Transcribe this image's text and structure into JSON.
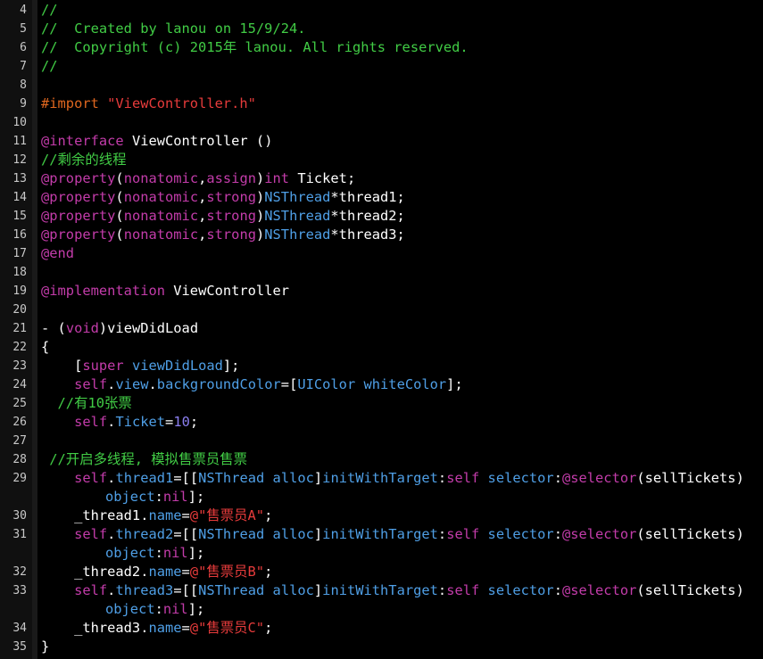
{
  "editor": {
    "lines": [
      {
        "n": "4",
        "tokens": [
          {
            "t": "//",
            "c": "comment"
          }
        ]
      },
      {
        "n": "5",
        "tokens": [
          {
            "t": "//  Created by lanou on 15/9/24.",
            "c": "comment"
          }
        ]
      },
      {
        "n": "6",
        "tokens": [
          {
            "t": "//  Copyright (c) 2015年 lanou. All rights reserved.",
            "c": "comment"
          }
        ]
      },
      {
        "n": "7",
        "tokens": [
          {
            "t": "//",
            "c": "comment"
          }
        ]
      },
      {
        "n": "8",
        "tokens": []
      },
      {
        "n": "9",
        "tokens": [
          {
            "t": "#import ",
            "c": "directive"
          },
          {
            "t": "\"ViewController.h\"",
            "c": "string"
          }
        ]
      },
      {
        "n": "10",
        "tokens": []
      },
      {
        "n": "11",
        "tokens": [
          {
            "t": "@interface",
            "c": "keyword"
          },
          {
            "t": " ViewController ()",
            "c": "plain"
          }
        ]
      },
      {
        "n": "12",
        "tokens": [
          {
            "t": "//剩余的线程",
            "c": "comment"
          }
        ]
      },
      {
        "n": "13",
        "tokens": [
          {
            "t": "@property",
            "c": "keyword"
          },
          {
            "t": "(",
            "c": "plain"
          },
          {
            "t": "nonatomic",
            "c": "keyword"
          },
          {
            "t": ",",
            "c": "plain"
          },
          {
            "t": "assign",
            "c": "keyword"
          },
          {
            "t": ")",
            "c": "plain"
          },
          {
            "t": "int",
            "c": "keyword"
          },
          {
            "t": " Ticket;",
            "c": "plain"
          }
        ]
      },
      {
        "n": "14",
        "tokens": [
          {
            "t": "@property",
            "c": "keyword"
          },
          {
            "t": "(",
            "c": "plain"
          },
          {
            "t": "nonatomic",
            "c": "keyword"
          },
          {
            "t": ",",
            "c": "plain"
          },
          {
            "t": "strong",
            "c": "keyword"
          },
          {
            "t": ")",
            "c": "plain"
          },
          {
            "t": "NSThread",
            "c": "type"
          },
          {
            "t": "*thread1;",
            "c": "plain"
          }
        ]
      },
      {
        "n": "15",
        "tokens": [
          {
            "t": "@property",
            "c": "keyword"
          },
          {
            "t": "(",
            "c": "plain"
          },
          {
            "t": "nonatomic",
            "c": "keyword"
          },
          {
            "t": ",",
            "c": "plain"
          },
          {
            "t": "strong",
            "c": "keyword"
          },
          {
            "t": ")",
            "c": "plain"
          },
          {
            "t": "NSThread",
            "c": "type"
          },
          {
            "t": "*thread2;",
            "c": "plain"
          }
        ]
      },
      {
        "n": "16",
        "tokens": [
          {
            "t": "@property",
            "c": "keyword"
          },
          {
            "t": "(",
            "c": "plain"
          },
          {
            "t": "nonatomic",
            "c": "keyword"
          },
          {
            "t": ",",
            "c": "plain"
          },
          {
            "t": "strong",
            "c": "keyword"
          },
          {
            "t": ")",
            "c": "plain"
          },
          {
            "t": "NSThread",
            "c": "type"
          },
          {
            "t": "*thread3;",
            "c": "plain"
          }
        ]
      },
      {
        "n": "17",
        "tokens": [
          {
            "t": "@end",
            "c": "keyword"
          }
        ]
      },
      {
        "n": "18",
        "tokens": []
      },
      {
        "n": "19",
        "tokens": [
          {
            "t": "@implementation",
            "c": "keyword"
          },
          {
            "t": " ViewController",
            "c": "plain"
          }
        ]
      },
      {
        "n": "20",
        "tokens": []
      },
      {
        "n": "21",
        "tokens": [
          {
            "t": "- (",
            "c": "plain"
          },
          {
            "t": "void",
            "c": "keyword"
          },
          {
            "t": ")viewDidLoad",
            "c": "plain"
          }
        ]
      },
      {
        "n": "22",
        "tokens": [
          {
            "t": "{",
            "c": "plain"
          }
        ]
      },
      {
        "n": "23",
        "tokens": [
          {
            "t": "    [",
            "c": "plain"
          },
          {
            "t": "super",
            "c": "keyword"
          },
          {
            "t": " ",
            "c": "plain"
          },
          {
            "t": "viewDidLoad",
            "c": "type"
          },
          {
            "t": "];",
            "c": "plain"
          }
        ]
      },
      {
        "n": "24",
        "tokens": [
          {
            "t": "    ",
            "c": "plain"
          },
          {
            "t": "self",
            "c": "keyword"
          },
          {
            "t": ".",
            "c": "plain"
          },
          {
            "t": "view",
            "c": "type"
          },
          {
            "t": ".",
            "c": "plain"
          },
          {
            "t": "backgroundColor",
            "c": "type"
          },
          {
            "t": "=[",
            "c": "plain"
          },
          {
            "t": "UIColor",
            "c": "type"
          },
          {
            "t": " ",
            "c": "plain"
          },
          {
            "t": "whiteColor",
            "c": "type"
          },
          {
            "t": "];",
            "c": "plain"
          }
        ]
      },
      {
        "n": "25",
        "tokens": [
          {
            "t": "  //有10张票",
            "c": "comment"
          }
        ]
      },
      {
        "n": "26",
        "tokens": [
          {
            "t": "    ",
            "c": "plain"
          },
          {
            "t": "self",
            "c": "keyword"
          },
          {
            "t": ".",
            "c": "plain"
          },
          {
            "t": "Ticket",
            "c": "type"
          },
          {
            "t": "=",
            "c": "plain"
          },
          {
            "t": "10",
            "c": "number"
          },
          {
            "t": ";",
            "c": "plain"
          }
        ]
      },
      {
        "n": "27",
        "tokens": []
      },
      {
        "n": "28",
        "tokens": [
          {
            "t": " //开启多线程, 模拟售票员售票",
            "c": "comment"
          }
        ]
      },
      {
        "n": "29",
        "tokens": [
          {
            "t": "    ",
            "c": "plain"
          },
          {
            "t": "self",
            "c": "keyword"
          },
          {
            "t": ".",
            "c": "plain"
          },
          {
            "t": "thread1",
            "c": "type"
          },
          {
            "t": "=[[",
            "c": "plain"
          },
          {
            "t": "NSThread",
            "c": "type"
          },
          {
            "t": " ",
            "c": "plain"
          },
          {
            "t": "alloc",
            "c": "type"
          },
          {
            "t": "]",
            "c": "plain"
          },
          {
            "t": "initWithTarget",
            "c": "type"
          },
          {
            "t": ":",
            "c": "plain"
          },
          {
            "t": "self",
            "c": "keyword"
          },
          {
            "t": " ",
            "c": "plain"
          },
          {
            "t": "selector",
            "c": "type"
          },
          {
            "t": ":",
            "c": "plain"
          },
          {
            "t": "@selector",
            "c": "keyword"
          },
          {
            "t": "(sellTickets)",
            "c": "plain"
          }
        ],
        "cont": [
          {
            "t": "object",
            "c": "type"
          },
          {
            "t": ":",
            "c": "plain"
          },
          {
            "t": "nil",
            "c": "keyword"
          },
          {
            "t": "];",
            "c": "plain"
          }
        ]
      },
      {
        "n": "30",
        "tokens": [
          {
            "t": "    _thread1.",
            "c": "plain"
          },
          {
            "t": "name",
            "c": "type"
          },
          {
            "t": "=",
            "c": "plain"
          },
          {
            "t": "@\"售票员A\"",
            "c": "string"
          },
          {
            "t": ";",
            "c": "plain"
          }
        ]
      },
      {
        "n": "31",
        "tokens": [
          {
            "t": "    ",
            "c": "plain"
          },
          {
            "t": "self",
            "c": "keyword"
          },
          {
            "t": ".",
            "c": "plain"
          },
          {
            "t": "thread2",
            "c": "type"
          },
          {
            "t": "=[[",
            "c": "plain"
          },
          {
            "t": "NSThread",
            "c": "type"
          },
          {
            "t": " ",
            "c": "plain"
          },
          {
            "t": "alloc",
            "c": "type"
          },
          {
            "t": "]",
            "c": "plain"
          },
          {
            "t": "initWithTarget",
            "c": "type"
          },
          {
            "t": ":",
            "c": "plain"
          },
          {
            "t": "self",
            "c": "keyword"
          },
          {
            "t": " ",
            "c": "plain"
          },
          {
            "t": "selector",
            "c": "type"
          },
          {
            "t": ":",
            "c": "plain"
          },
          {
            "t": "@selector",
            "c": "keyword"
          },
          {
            "t": "(sellTickets)",
            "c": "plain"
          }
        ],
        "cont": [
          {
            "t": "object",
            "c": "type"
          },
          {
            "t": ":",
            "c": "plain"
          },
          {
            "t": "nil",
            "c": "keyword"
          },
          {
            "t": "];",
            "c": "plain"
          }
        ]
      },
      {
        "n": "32",
        "tokens": [
          {
            "t": "    _thread2.",
            "c": "plain"
          },
          {
            "t": "name",
            "c": "type"
          },
          {
            "t": "=",
            "c": "plain"
          },
          {
            "t": "@\"售票员B\"",
            "c": "string"
          },
          {
            "t": ";",
            "c": "plain"
          }
        ]
      },
      {
        "n": "33",
        "tokens": [
          {
            "t": "    ",
            "c": "plain"
          },
          {
            "t": "self",
            "c": "keyword"
          },
          {
            "t": ".",
            "c": "plain"
          },
          {
            "t": "thread3",
            "c": "type"
          },
          {
            "t": "=[[",
            "c": "plain"
          },
          {
            "t": "NSThread",
            "c": "type"
          },
          {
            "t": " ",
            "c": "plain"
          },
          {
            "t": "alloc",
            "c": "type"
          },
          {
            "t": "]",
            "c": "plain"
          },
          {
            "t": "initWithTarget",
            "c": "type"
          },
          {
            "t": ":",
            "c": "plain"
          },
          {
            "t": "self",
            "c": "keyword"
          },
          {
            "t": " ",
            "c": "plain"
          },
          {
            "t": "selector",
            "c": "type"
          },
          {
            "t": ":",
            "c": "plain"
          },
          {
            "t": "@selector",
            "c": "keyword"
          },
          {
            "t": "(sellTickets)",
            "c": "plain"
          }
        ],
        "cont": [
          {
            "t": "object",
            "c": "type"
          },
          {
            "t": ":",
            "c": "plain"
          },
          {
            "t": "nil",
            "c": "keyword"
          },
          {
            "t": "];",
            "c": "plain"
          }
        ]
      },
      {
        "n": "34",
        "tokens": [
          {
            "t": "    _thread3.",
            "c": "plain"
          },
          {
            "t": "name",
            "c": "type"
          },
          {
            "t": "=",
            "c": "plain"
          },
          {
            "t": "@\"售票员C\"",
            "c": "string"
          },
          {
            "t": ";",
            "c": "plain"
          }
        ]
      },
      {
        "n": "35",
        "tokens": [
          {
            "t": "}",
            "c": "plain"
          }
        ]
      }
    ]
  },
  "colors": {
    "background": "#000000",
    "comment": "#41cc45",
    "directive": "#e0671f",
    "string": "#e63b3b",
    "keyword": "#c33caa",
    "type": "#4f9fe6",
    "number": "#8b7ff0",
    "plain": "#ffffff"
  }
}
